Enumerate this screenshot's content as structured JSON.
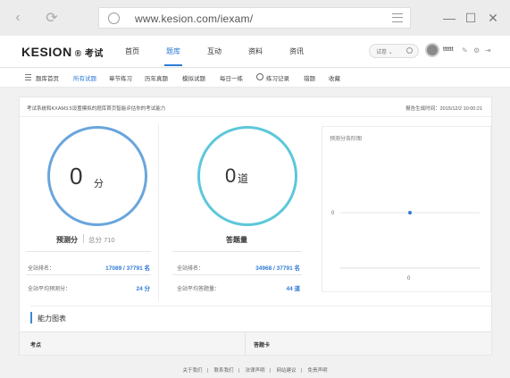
{
  "browser": {
    "url": "www.kesion.com/iexam/"
  },
  "header": {
    "logo": "KESION",
    "logo_sub": "® 考试",
    "nav": [
      "首页",
      "题库",
      "互动",
      "资料",
      "资讯"
    ],
    "active_nav": 1,
    "search_type": "试卷 ⌄",
    "username": "tttttt"
  },
  "subnav": {
    "items": [
      "题库首页",
      "所有试题",
      "章节练习",
      "历年真题",
      "模拟试题",
      "每日一练",
      "练习记录",
      "错题",
      "收藏"
    ],
    "active": 1
  },
  "info": {
    "description": "考试系统和KXAM3.5设置模拟的题库首页智能评估你的考试能力",
    "time": "报告生成时间：2015/12/2 10:00:21"
  },
  "predict": {
    "value": "0",
    "unit": "分",
    "title": "预测分",
    "total": "总分 710",
    "rank_label": "全站排名：",
    "rank_value": "17089 / 37791 名",
    "avg_label": "全站平均预测分：",
    "avg_value": "24 分"
  },
  "answered": {
    "value": "0",
    "unit": "道",
    "title": "答题量",
    "rank_label": "全站排名：",
    "rank_value": "34968 / 37791 名",
    "avg_label": "全站平均答题量：",
    "avg_value": "44 道"
  },
  "chart_data": {
    "type": "scatter",
    "title": "预测分各阶图",
    "x": [
      0
    ],
    "y": [
      0
    ],
    "y_tick": "0",
    "x_tick": "0"
  },
  "ability": {
    "title": "能力图表",
    "columns": [
      "考点",
      "答题卡"
    ]
  },
  "footer": [
    "关于我们",
    "联系我们",
    "法律声明",
    "网站建议",
    "免责声明"
  ],
  "colors": {
    "accent": "#2e7bd8",
    "ring_predict": "#6aa5dd",
    "ring_answered": "#5cc8d9"
  }
}
